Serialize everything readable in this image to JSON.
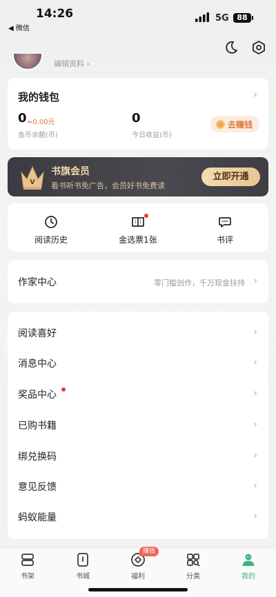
{
  "status_bar": {
    "time": "14:26",
    "back_app": "◀ 微信",
    "network": "5G",
    "battery": "88"
  },
  "profile": {
    "edit_text": "编辑资料 ›"
  },
  "wallet": {
    "title": "我的钱包",
    "coin_balance": "0",
    "coin_cny": "≈0.00元",
    "coin_label": "金币余额(币)",
    "today_income": "0",
    "today_label": "今日收益(币)",
    "earn_button": "去赚钱"
  },
  "vip": {
    "title": "书旗会员",
    "subtitle": "看书听书免广告，会员好书免费读",
    "button": "立即开通"
  },
  "shortcuts": [
    {
      "label": "阅读历史",
      "icon": "clock-icon"
    },
    {
      "label": "金选票1张",
      "icon": "ticket-icon"
    },
    {
      "label": "书评",
      "icon": "comment-icon"
    }
  ],
  "writer": {
    "title": "作家中心",
    "subtitle": "零门槛创作，千万现金扶持"
  },
  "menu": [
    {
      "label": "阅读喜好"
    },
    {
      "label": "消息中心"
    },
    {
      "label": "奖品中心"
    },
    {
      "label": "已购书籍"
    },
    {
      "label": "绑兑换码"
    },
    {
      "label": "意见反馈"
    },
    {
      "label": "蚂蚁能量"
    }
  ],
  "tabs": [
    {
      "label": "书架",
      "icon": "bookshelf-icon"
    },
    {
      "label": "书城",
      "icon": "bookstore-icon"
    },
    {
      "label": "福利",
      "icon": "welfare-icon",
      "badge": "赚钱"
    },
    {
      "label": "分类",
      "icon": "category-icon"
    },
    {
      "label": "我的",
      "icon": "profile-icon",
      "active": true
    }
  ],
  "colors": {
    "accent_green": "#3bb37f",
    "earn_orange": "#e07a3a",
    "vip_gold": "#f2d6a6",
    "notify_red": "#e93a3a"
  }
}
